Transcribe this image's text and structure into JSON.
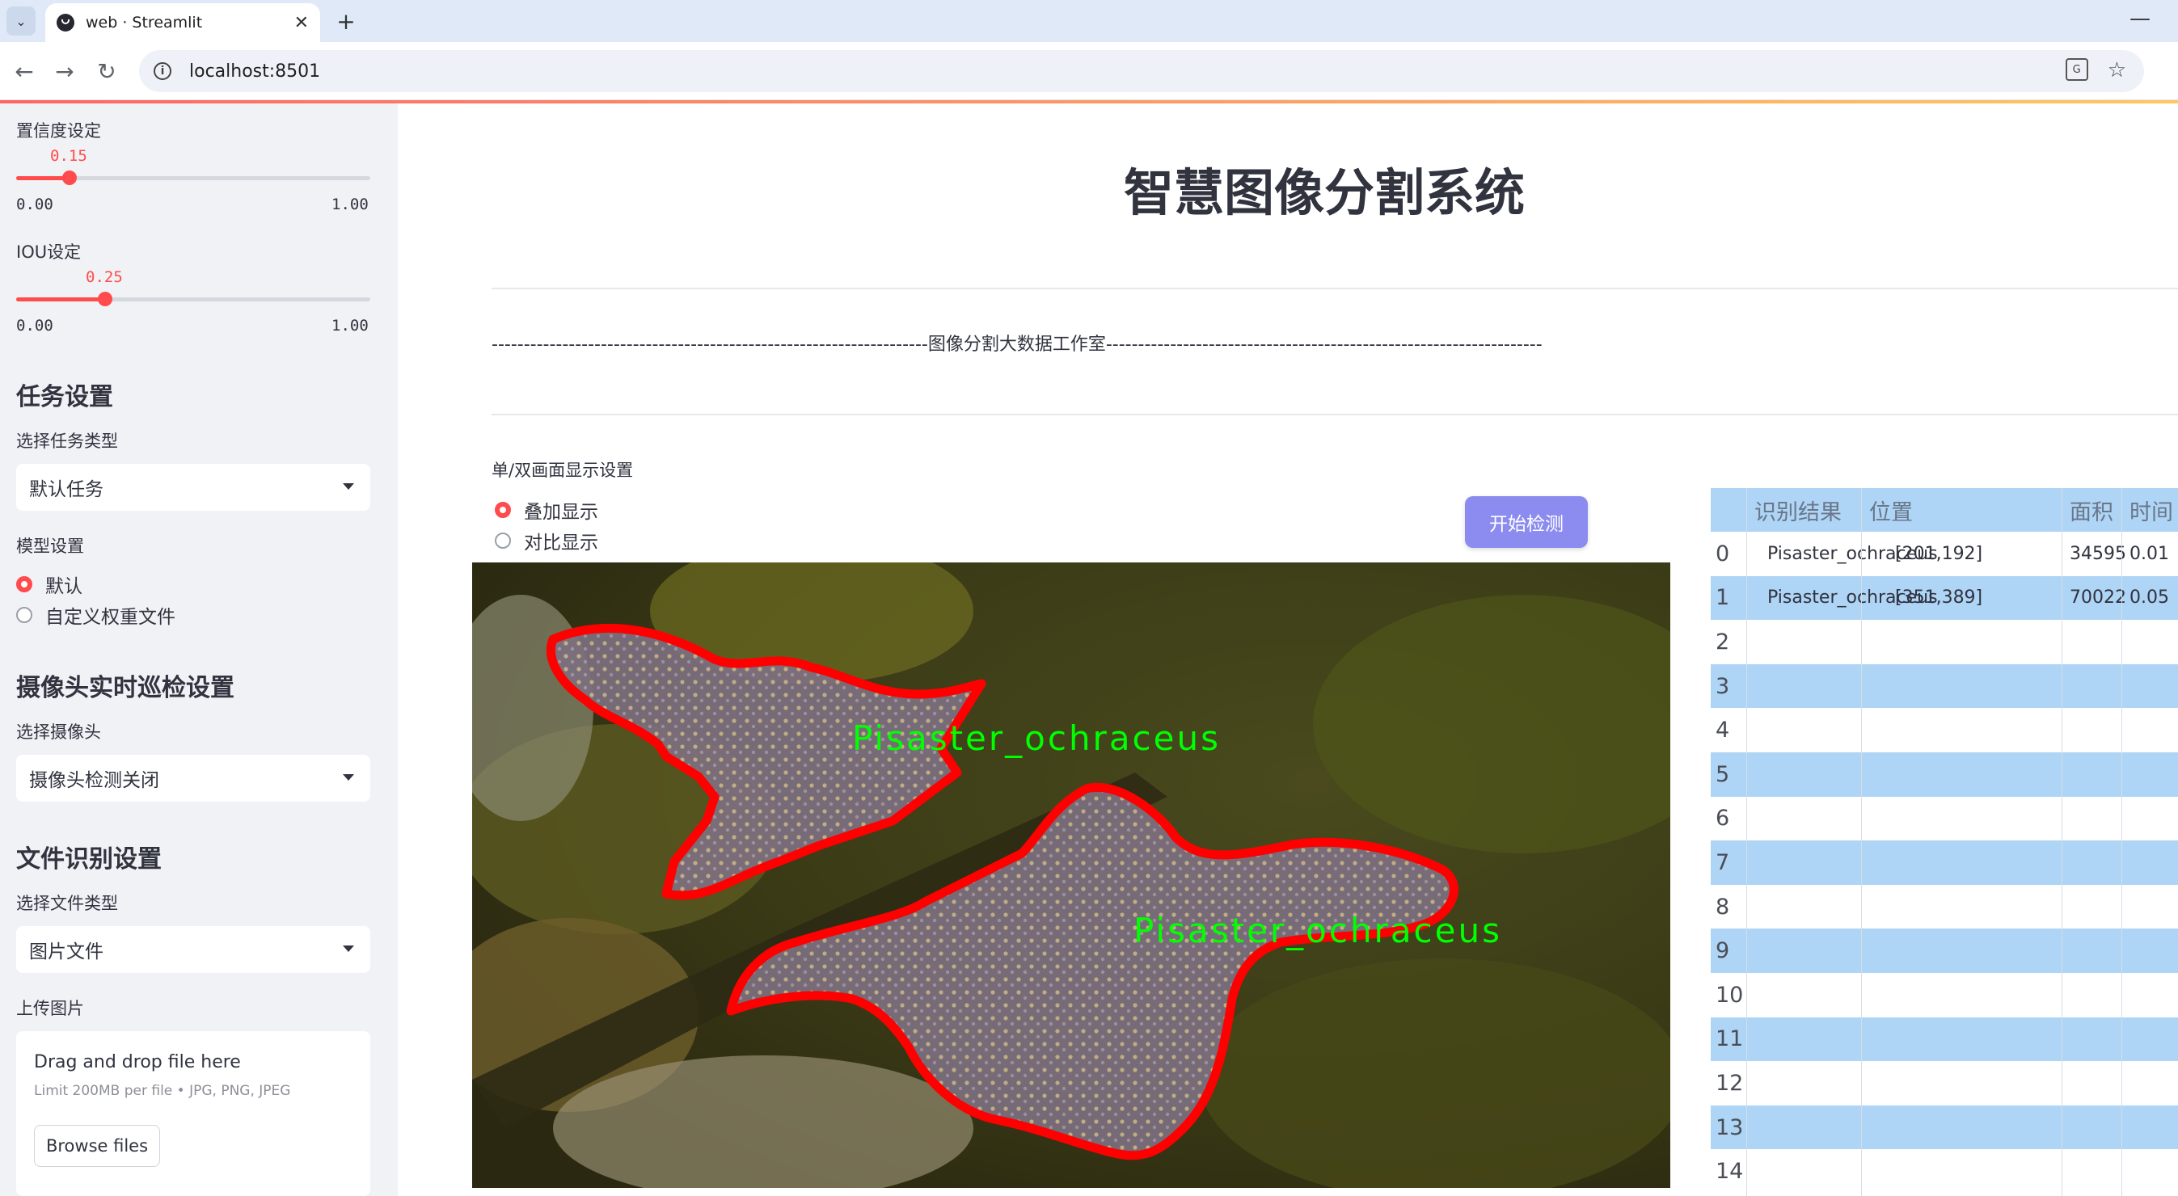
{
  "browser": {
    "tab_title": "web · Streamlit",
    "url": "localhost:8501"
  },
  "sidebar": {
    "confidence": {
      "label": "置信度设定",
      "value": "0.15",
      "min": "0.00",
      "max": "1.00",
      "fraction": 0.15
    },
    "iou": {
      "label": "IOU设定",
      "value": "0.25",
      "min": "0.00",
      "max": "1.00",
      "fraction": 0.25
    },
    "task_heading": "任务设置",
    "task_type_label": "选择任务类型",
    "task_type_value": "默认任务",
    "model_label": "模型设置",
    "model_options": [
      "默认",
      "自定义权重文件"
    ],
    "model_selected": 0,
    "camera_heading": "摄像头实时巡检设置",
    "camera_label": "选择摄像头",
    "camera_value": "摄像头检测关闭",
    "file_heading": "文件识别设置",
    "file_type_label": "选择文件类型",
    "file_type_value": "图片文件",
    "upload_label": "上传图片",
    "uploader": {
      "title": "Drag and drop file here",
      "subtitle": "Limit 200MB per file • JPG, PNG, JPEG",
      "button": "Browse files"
    }
  },
  "main": {
    "title": "智慧图像分割系统",
    "divider_text": "--------------------------------------------------------------------图像分割大数据工作室--------------------------------------------------------------------",
    "display_mode_label": "单/双画面显示设置",
    "display_options": [
      "叠加显示",
      "对比显示"
    ],
    "display_selected": 0,
    "start_button": "开始检测",
    "detections": [
      {
        "label": "Pisaster_ochraceus"
      },
      {
        "label": "Pisaster_ochraceus"
      }
    ]
  },
  "results_table": {
    "columns": [
      "识别结果",
      "位置",
      "面积",
      "时间"
    ],
    "rows": [
      {
        "idx": "0",
        "result": "Pisaster_ochraceus",
        "position": "[201,192]",
        "area": "34595",
        "time": "0.01"
      },
      {
        "idx": "1",
        "result": "Pisaster_ochraceus",
        "position": "[351,389]",
        "area": "70022",
        "time": "0.05"
      },
      {
        "idx": "2"
      },
      {
        "idx": "3"
      },
      {
        "idx": "4"
      },
      {
        "idx": "5"
      },
      {
        "idx": "6"
      },
      {
        "idx": "7"
      },
      {
        "idx": "8"
      },
      {
        "idx": "9"
      },
      {
        "idx": "10"
      },
      {
        "idx": "11"
      },
      {
        "idx": "12"
      },
      {
        "idx": "13"
      },
      {
        "idx": "14"
      }
    ]
  },
  "colors": {
    "accent": "#ff4b4b",
    "sidebar_bg": "#f0f2f6",
    "table_stripe": "#aed4f6",
    "button": "#8c8cf0",
    "mask_outline": "#ff0000",
    "mask_label": "#00ff00"
  }
}
